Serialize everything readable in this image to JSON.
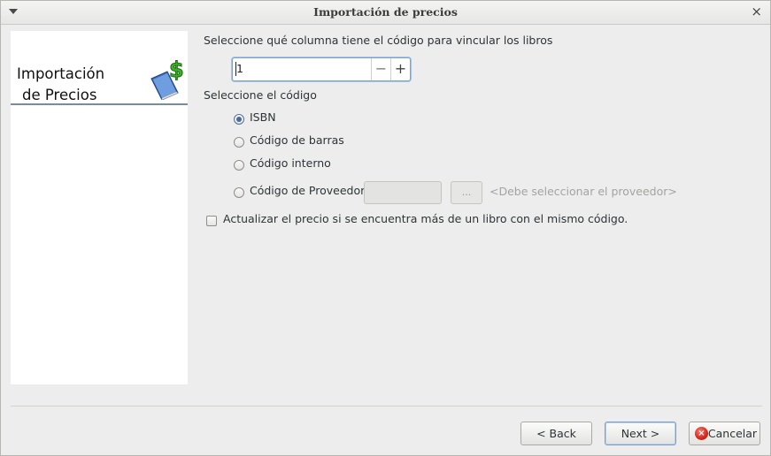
{
  "window": {
    "title": "Importación de precios",
    "close_glyph": "×"
  },
  "sidebar": {
    "title_line1": "Importación",
    "title_line2": "de Precios",
    "icon": "book-dollar-icon"
  },
  "column_section": {
    "label": "Seleccione qué columna tiene el código para vincular los libros",
    "spinner_value": "1",
    "minus_glyph": "−",
    "plus_glyph": "+"
  },
  "code_section": {
    "label": "Seleccione el código",
    "options": [
      {
        "label": "ISBN",
        "selected": true
      },
      {
        "label": "Código de barras",
        "selected": false
      },
      {
        "label": "Código interno",
        "selected": false
      },
      {
        "label": "Código de Proveedor",
        "selected": false
      }
    ],
    "provider_button_label": "...",
    "provider_hint": "<Debe seleccionar el proveedor>"
  },
  "update_checkbox": {
    "label": "Actualizar el precio si se encuentra más de un libro con el mismo código.",
    "checked": false
  },
  "footer": {
    "back_label": "< Back",
    "next_label": "Next >",
    "cancel_label": "Cancelar",
    "cancel_icon_glyph": "×"
  }
}
